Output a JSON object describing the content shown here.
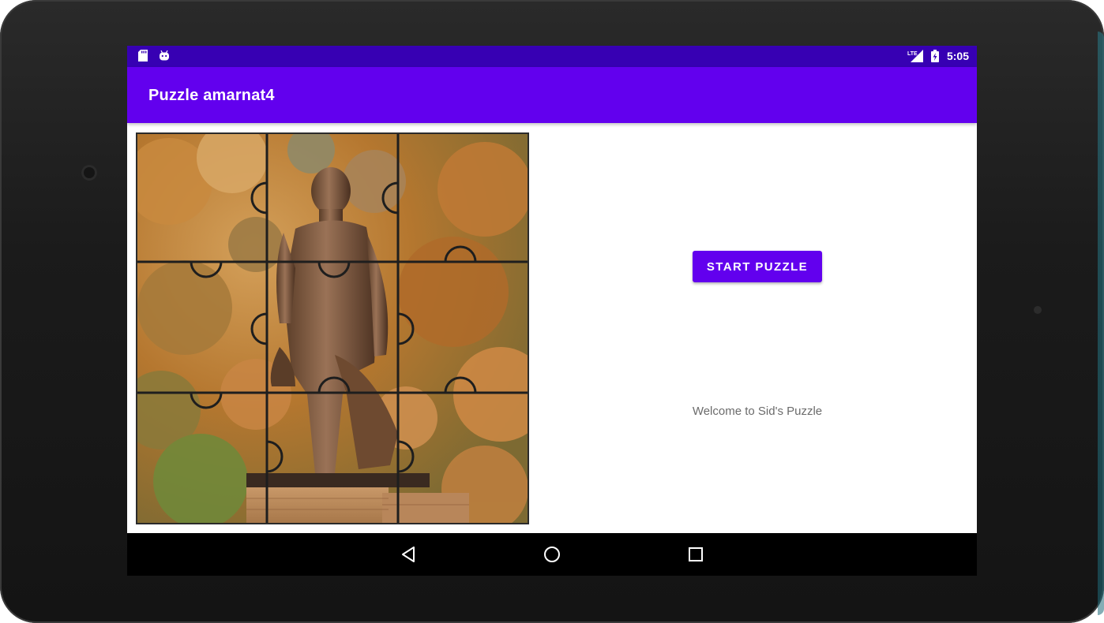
{
  "status_bar": {
    "time": "5:05",
    "icons": [
      "sd-card-icon",
      "android-icon",
      "lte-signal-icon",
      "battery-charging-icon"
    ],
    "lte_label": "LTE"
  },
  "app_bar": {
    "title": "Puzzle amarnat4"
  },
  "main": {
    "puzzle_image_name": "puzzle-image",
    "start_button_label": "START PUZZLE",
    "welcome_text": "Welcome to Sid's Puzzle"
  },
  "nav_bar": {
    "icons": [
      "back-icon",
      "home-icon",
      "recents-icon"
    ]
  },
  "colors": {
    "status_bar": "#3700b3",
    "app_bar": "#6200ee",
    "button": "#6200ee",
    "nav_bar": "#000000"
  }
}
